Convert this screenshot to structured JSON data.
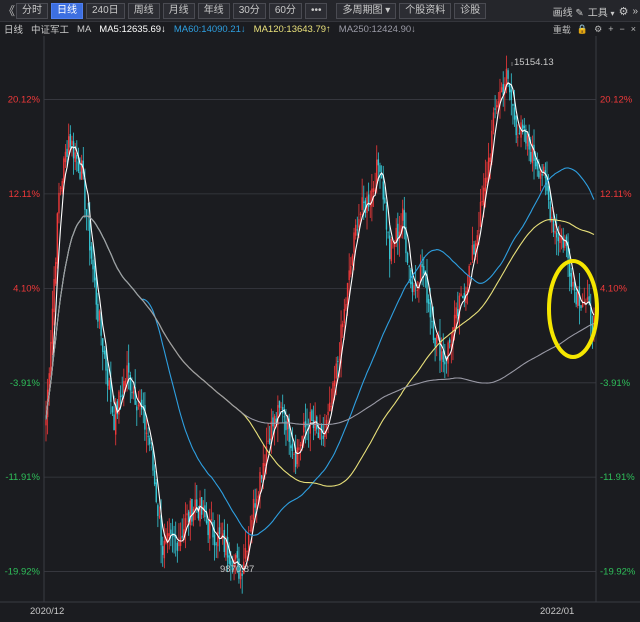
{
  "toolbar": {
    "back_glyph": "《",
    "tabs": [
      {
        "label": "分时",
        "active": false
      },
      {
        "label": "日线",
        "active": true
      },
      {
        "label": "240日",
        "active": false
      },
      {
        "label": "周线",
        "active": false
      },
      {
        "label": "月线",
        "active": false
      },
      {
        "label": "年线",
        "active": false
      },
      {
        "label": "30分",
        "active": false
      },
      {
        "label": "60分",
        "active": false
      },
      {
        "label": "•••",
        "active": false
      },
      {
        "label": "多周期图 ▾",
        "active": false
      },
      {
        "label": "个股资料",
        "active": false
      },
      {
        "label": "诊股",
        "active": false
      }
    ],
    "right": {
      "draw_label": "画线",
      "tools_label": "工具",
      "more_label": "»"
    }
  },
  "ma_bar": {
    "period": "日线",
    "index_name": "中证军工",
    "ma_label": "MA",
    "ma5": "MA5:12635.69↓",
    "ma60": "MA60:14090.21↓",
    "ma120": "MA120:13643.79↑",
    "ma250": "MA250:12424.90↓",
    "reweight": "重载"
  },
  "colors": {
    "up": "#f0393a",
    "down": "#35c8d6",
    "ma5": "#ffffff",
    "ma60": "#2e9fe0",
    "ma120": "#e8e07a",
    "ma250": "#9a9aa6",
    "highlight": "#f5e600",
    "grid": "#3a3b42"
  },
  "chart_data": {
    "type": "candlestick",
    "y_axis_labels": [
      "20.12%",
      "12.11%",
      "4.10%",
      "-3.91%",
      "-11.91%",
      "-19.92%"
    ],
    "y_axis_values": [
      20.12,
      12.11,
      4.1,
      -3.91,
      -11.91,
      -19.92
    ],
    "ylim": [
      -22.5,
      25.5
    ],
    "x_axis_labels": [
      "2020/12",
      "2022/01"
    ],
    "annotations": {
      "high": "15154.13",
      "low": "9870.87"
    }
  }
}
